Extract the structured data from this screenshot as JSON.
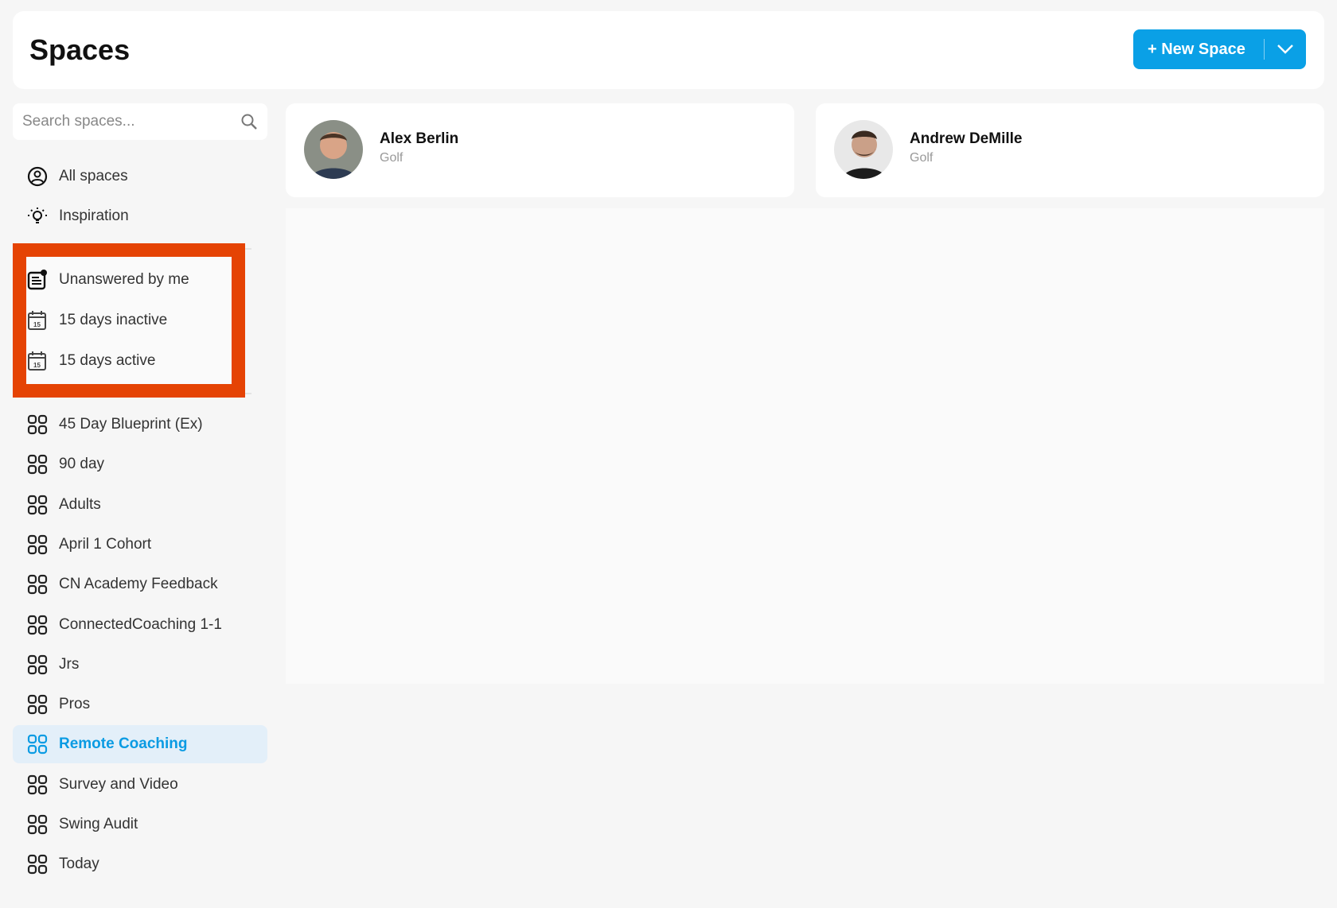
{
  "header": {
    "title": "Spaces",
    "new_space_label": "+ New Space"
  },
  "search": {
    "placeholder": "Search spaces..."
  },
  "nav_top": [
    {
      "label": "All spaces",
      "icon": "user-circle-icon"
    },
    {
      "label": "Inspiration",
      "icon": "lightbulb-icon"
    }
  ],
  "filters": [
    {
      "label": "Unanswered by me",
      "icon": "unanswered-icon"
    },
    {
      "label": "15 days inactive",
      "icon": "calendar-15-icon"
    },
    {
      "label": "15 days active",
      "icon": "calendar-15-icon"
    }
  ],
  "spaces": [
    {
      "label": "45 Day Blueprint (Ex)"
    },
    {
      "label": "90 day"
    },
    {
      "label": "Adults"
    },
    {
      "label": "April 1 Cohort"
    },
    {
      "label": "CN Academy Feedback"
    },
    {
      "label": "ConnectedCoaching 1-1"
    },
    {
      "label": "Jrs"
    },
    {
      "label": "Pros"
    },
    {
      "label": "Remote Coaching",
      "active": true
    },
    {
      "label": "Survey and Video"
    },
    {
      "label": "Swing Audit"
    },
    {
      "label": "Today"
    }
  ],
  "members": [
    {
      "name": "Alex Berlin",
      "sport": "Golf"
    },
    {
      "name": "Andrew DeMille",
      "sport": "Golf"
    }
  ],
  "colors": {
    "accent": "#0aa0e6",
    "highlight": "#e54304",
    "active_bg": "#e3eff9"
  }
}
